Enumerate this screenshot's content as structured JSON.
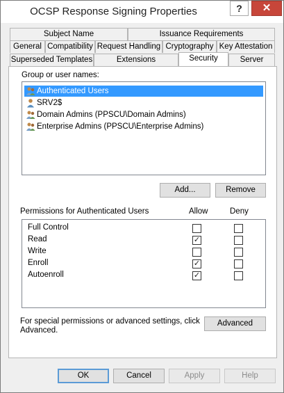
{
  "window": {
    "title": "OCSP Response Signing Properties",
    "help_label": "?",
    "close_label": "✕"
  },
  "tabs": {
    "row1": [
      {
        "label": "Subject Name"
      },
      {
        "label": "Issuance Requirements"
      }
    ],
    "row2": [
      {
        "label": "General"
      },
      {
        "label": "Compatibility"
      },
      {
        "label": "Request Handling"
      },
      {
        "label": "Cryptography"
      },
      {
        "label": "Key Attestation"
      }
    ],
    "row3": [
      {
        "label": "Superseded Templates"
      },
      {
        "label": "Extensions"
      },
      {
        "label": "Security"
      },
      {
        "label": "Server"
      }
    ],
    "active": "Security"
  },
  "security": {
    "group_label": "Group or user names:",
    "users": [
      {
        "name": "Authenticated Users",
        "selected": true,
        "icon": "users-group-icon"
      },
      {
        "name": "SRV2$",
        "selected": false,
        "icon": "user-icon"
      },
      {
        "name": "Domain Admins (PPSCU\\Domain Admins)",
        "selected": false,
        "icon": "users-group-icon"
      },
      {
        "name": "Enterprise Admins (PPSCU\\Enterprise Admins)",
        "selected": false,
        "icon": "users-group-icon"
      }
    ],
    "add_label": "Add...",
    "remove_label": "Remove",
    "permissions_label": "Permissions for Authenticated Users",
    "allow_header": "Allow",
    "deny_header": "Deny",
    "permissions": [
      {
        "name": "Full Control",
        "allow": false,
        "deny": false
      },
      {
        "name": "Read",
        "allow": true,
        "deny": false
      },
      {
        "name": "Write",
        "allow": false,
        "deny": false
      },
      {
        "name": "Enroll",
        "allow": true,
        "deny": false
      },
      {
        "name": "Autoenroll",
        "allow": true,
        "deny": false
      }
    ],
    "special_text_line1": "For special permissions or advanced settings, click",
    "special_text_line2": "Advanced.",
    "advanced_label": "Advanced"
  },
  "footer": {
    "ok_label": "OK",
    "cancel_label": "Cancel",
    "apply_label": "Apply",
    "help_label": "Help"
  }
}
